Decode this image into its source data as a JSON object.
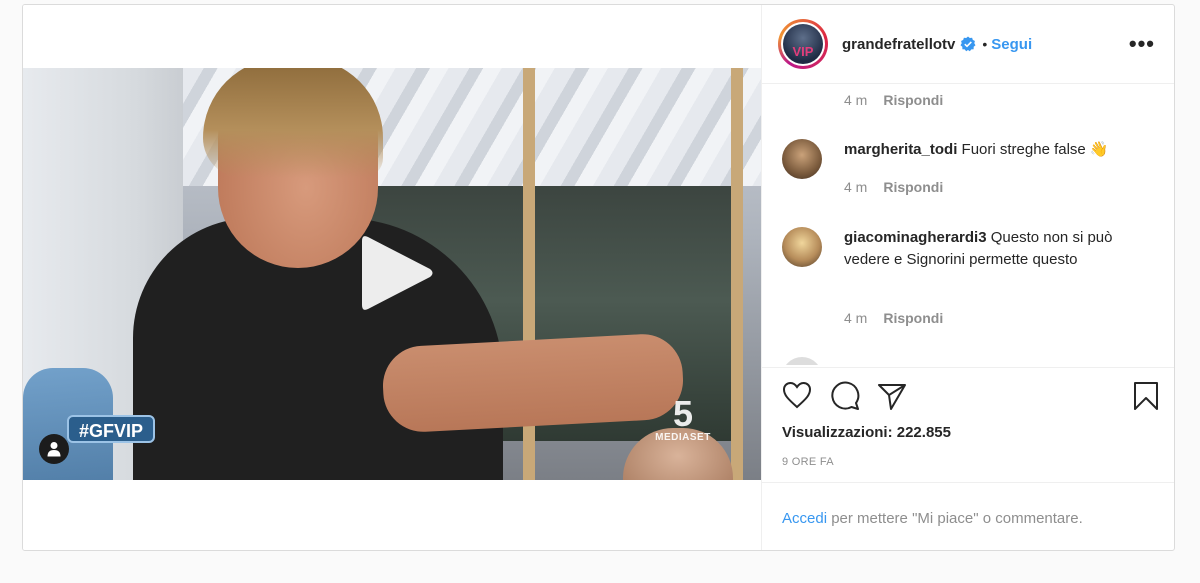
{
  "video": {
    "hashtag": "#GFVIP",
    "watermark_number": "5",
    "watermark_text": "MEDIASET"
  },
  "header": {
    "username": "grandefratellotv",
    "separator": "•",
    "follow_label": "Segui",
    "more_label": "•••",
    "avatar_text": "VIP"
  },
  "comments": [
    {
      "username": "",
      "text": "",
      "age": "4 m",
      "reply_label": "Rispondi"
    },
    {
      "username": "margherita_todi",
      "text": "Fuori streghe false 👋",
      "age": "4 m",
      "reply_label": "Rispondi"
    },
    {
      "username": "giacominagherardi3",
      "text": "Questo non si può vedere e Signorini permette questo",
      "age": "4 m",
      "reply_label": "Rispondi"
    }
  ],
  "stats": {
    "views": "Visualizzazioni: 222.855",
    "timestamp": "9 ORE FA"
  },
  "login_prompt": {
    "link": "Accedi",
    "text": " per mettere \"Mi piace\" o commentare."
  },
  "colors": {
    "link": "#3897f0",
    "verified": "#3897f0",
    "text": "#262626",
    "muted": "#8e8e8e"
  }
}
